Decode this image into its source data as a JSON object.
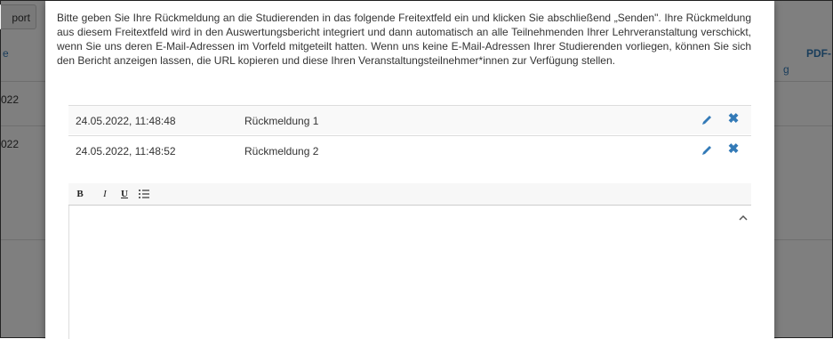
{
  "background": {
    "export_button": "port",
    "col_e": "e",
    "col_g": "g",
    "col_pdf": "PDF-",
    "row_dates": [
      "022",
      "022"
    ]
  },
  "modal": {
    "intro_text": "Bitte geben Sie Ihre Rückmeldung an die Studierenden in das folgende Freitextfeld ein und klicken Sie abschließend „Senden\". Ihre Rückmeldung aus diesem Freitextfeld wird in den Auswertungsbericht integriert und dann automatisch an alle Teilnehmenden Ihrer Lehrveranstaltung verschickt, wenn Sie uns deren E-Mail-Adressen im Vorfeld mitgeteilt hatten. Wenn uns keine E-Mail-Adressen Ihrer Studierenden vorliegen, können Sie sich den Bericht anzeigen lassen, die URL kopieren und diese Ihren Veranstaltungsteilnehmer*innen zur Verfügung stellen.",
    "feedback_items": [
      {
        "date": "24.05.2022, 11:48:48",
        "label": "Rückmeldung 1"
      },
      {
        "date": "24.05.2022, 11:48:52",
        "label": "Rückmeldung 2"
      }
    ],
    "editor": {
      "toolbar": {
        "bold": "B",
        "italic": "I",
        "underline": "U",
        "list": "☰"
      },
      "content": ""
    }
  },
  "colors": {
    "accent": "#337ab7",
    "overlay": "rgba(0,0,0,0.5)"
  },
  "icons": {
    "edit": "pencil-icon",
    "delete": "close-icon"
  }
}
